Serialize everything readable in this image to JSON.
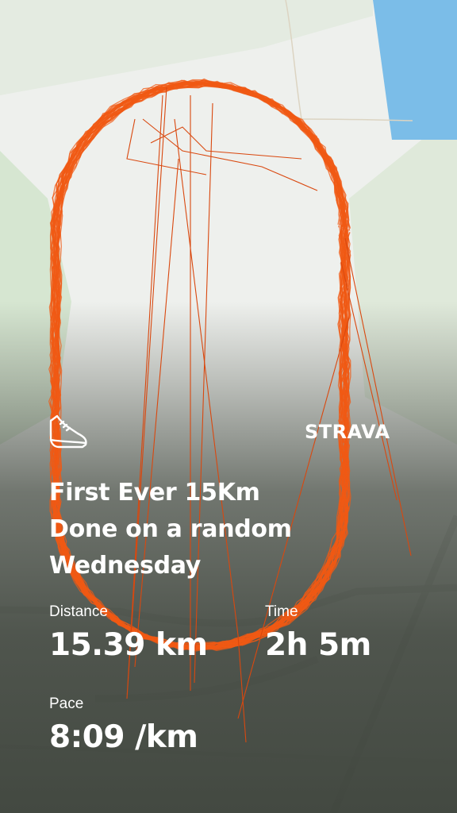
{
  "activity": {
    "title_lines": [
      "First Ever 15Km",
      "Done on a random",
      "Wednesday"
    ]
  },
  "brand": {
    "name": "STRAVA"
  },
  "stats": {
    "distance": {
      "label": "Distance",
      "value": "15.39 km"
    },
    "time": {
      "label": "Time",
      "value": "2h 5m"
    },
    "pace": {
      "label": "Pace",
      "value": "8:09 /km"
    }
  },
  "icons": {
    "activity_type": "running-shoe-icon"
  },
  "colors": {
    "route": "#f05a14",
    "water": "#7bbde8",
    "park": "#d9e8d4",
    "map_background": "#eef0ed",
    "text": "#ffffff"
  }
}
